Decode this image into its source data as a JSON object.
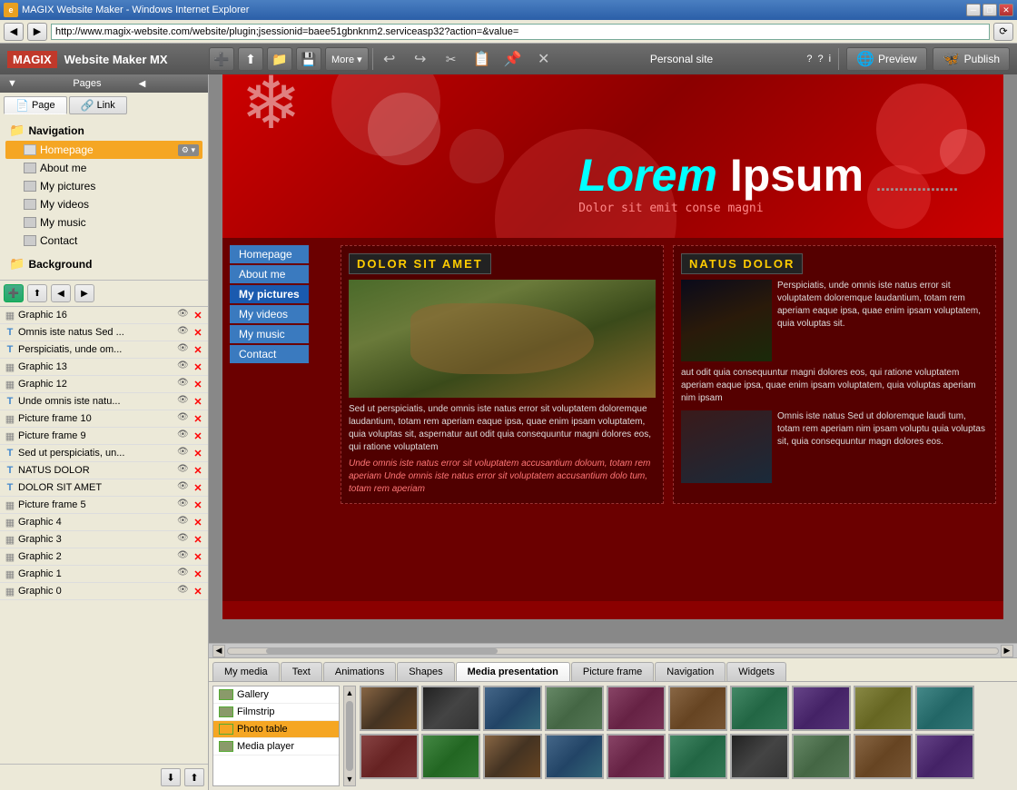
{
  "window": {
    "title": "MAGIX Website Maker - Windows Internet Explorer",
    "url": "http://www.magix-website.com/website/plugin;jsessionid=baee51gbnknm2.serviceasp32?action=&value=",
    "minimize": "─",
    "maximize": "□",
    "close": "✕"
  },
  "app": {
    "logo": "MAGIX",
    "title": "Website Maker MX",
    "site_name": "Personal site",
    "help": "?",
    "help2": "?",
    "help3": "i"
  },
  "toolbar": {
    "more_label": "More ▾",
    "preview_label": "Preview",
    "publish_label": "Publish"
  },
  "sidebar": {
    "header": "Pages",
    "collapse": "◀",
    "tab_page": "Page",
    "tab_link": "Link",
    "tree": {
      "navigation_label": "Navigation",
      "items": [
        {
          "label": "Homepage",
          "active": true,
          "indent": 1
        },
        {
          "label": "About me",
          "indent": 1
        },
        {
          "label": "My pictures",
          "indent": 1
        },
        {
          "label": "My videos",
          "indent": 1
        },
        {
          "label": "My music",
          "indent": 1
        },
        {
          "label": "Contact",
          "indent": 1
        }
      ],
      "background_label": "Background"
    },
    "layers": [
      {
        "name": "Graphic 16",
        "type": "img"
      },
      {
        "name": "Omnis iste natus Sed ...",
        "type": "text"
      },
      {
        "name": "Perspiciatis, unde om...",
        "type": "text"
      },
      {
        "name": "Graphic 13",
        "type": "img"
      },
      {
        "name": "Graphic 12",
        "type": "img"
      },
      {
        "name": "Unde omnis iste natu...",
        "type": "text"
      },
      {
        "name": "Picture frame 10",
        "type": "img"
      },
      {
        "name": "Picture frame 9",
        "type": "img"
      },
      {
        "name": "Sed ut perspiciatis, un...",
        "type": "text"
      },
      {
        "name": "NATUS DOLOR",
        "type": "text"
      },
      {
        "name": "DOLOR SIT AMET",
        "type": "text"
      },
      {
        "name": "Picture frame 5",
        "type": "img"
      },
      {
        "name": "Graphic 4",
        "type": "img"
      },
      {
        "name": "Graphic 3",
        "type": "img"
      },
      {
        "name": "Graphic 2",
        "type": "img"
      },
      {
        "name": "Graphic 1",
        "type": "img"
      },
      {
        "name": "Graphic 0",
        "type": "img"
      }
    ]
  },
  "canvas": {
    "nav_items": [
      "Homepage",
      "About me",
      "My pictures",
      "My videos",
      "My music",
      "Contact"
    ],
    "hero": {
      "lorem": "Lorem",
      "ipsum": "Ipsum",
      "dots": "..................",
      "dolor": "Dolor sit emit conse magni"
    },
    "section1": {
      "title": "DOLOR SIT AMET",
      "text": "Sed ut perspiciatis, unde omnis iste natus error sit voluptatem doloremque laudantium, totam rem aperiam eaque ipsa, quae enim ipsam voluptatem, quia  voluptas sit, aspernatur aut odit quia consequuntur magni dolores eos, qui ratione voluptatem",
      "text_red": "Unde omnis iste natus error sit voluptatem accusantium doloum, totam rem aperiam Unde omnis iste natus error sit voluptatem accusantium  dolo tum, totam rem aperiam"
    },
    "section2": {
      "title": "NATUS DOLOR",
      "text1": "Perspiciatis, unde omnis iste natus error sit voluptatem doloremque laudantium, totam rem aperiam eaque ipsa, quae enim ipsam voluptatem, quia  voluptas sit.",
      "text2": "aut odit quia consequuntur magni dolores eos, qui ratione voluptatem aperiam eaque ipsa, quae enim ipsam voluptatem, quia voluptas  aperiam nim ipsam",
      "text3": "Omnis iste natus Sed ut doloremque laudi tum, totam rem aperiam nim ipsam voluptu quia voluptas sit, quia consequuntur magn dolores eos."
    }
  },
  "bottom_tabs": [
    "My media",
    "Text",
    "Animations",
    "Shapes",
    "Media presentation",
    "Picture frame",
    "Navigation",
    "Widgets"
  ],
  "media_panel": {
    "active_tab": "Media presentation",
    "list_items": [
      {
        "label": "Gallery",
        "active": false
      },
      {
        "label": "Filmstrip",
        "active": false
      },
      {
        "label": "Photo table",
        "active": true
      },
      {
        "label": "Media player",
        "active": false
      }
    ],
    "thumbs": [
      {
        "class": "t1"
      },
      {
        "class": "t2"
      },
      {
        "class": "t3"
      },
      {
        "class": "t4"
      },
      {
        "class": "t5"
      },
      {
        "class": "t6"
      },
      {
        "class": "t7"
      },
      {
        "class": "t8"
      },
      {
        "class": "t9"
      },
      {
        "class": "t10"
      },
      {
        "class": "t11"
      },
      {
        "class": "t12"
      },
      {
        "class": "t1"
      },
      {
        "class": "t3"
      },
      {
        "class": "t5"
      },
      {
        "class": "t7"
      },
      {
        "class": "t2"
      },
      {
        "class": "t4"
      },
      {
        "class": "t6"
      },
      {
        "class": "t8"
      }
    ]
  }
}
